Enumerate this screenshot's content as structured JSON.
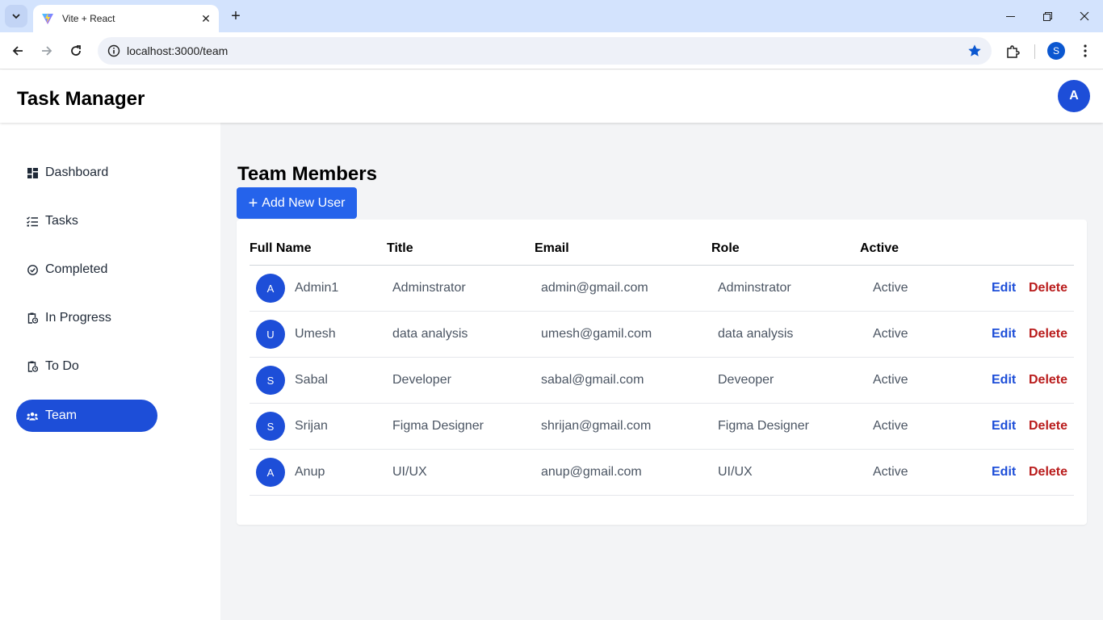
{
  "browser": {
    "tab_title": "Vite + React",
    "url": "localhost:3000/team",
    "profile_initial": "S"
  },
  "app": {
    "title": "Task Manager",
    "user_initial": "A",
    "accent_color": "#1d4ed8"
  },
  "sidebar": {
    "items": [
      {
        "label": "Dashboard",
        "icon": "dashboard-icon"
      },
      {
        "label": "Tasks",
        "icon": "tasks-list-icon"
      },
      {
        "label": "Completed",
        "icon": "check-circle-icon"
      },
      {
        "label": "In Progress",
        "icon": "clipboard-clock-icon"
      },
      {
        "label": "To Do",
        "icon": "clipboard-clock-icon"
      },
      {
        "label": "Team",
        "icon": "users-icon",
        "active": true
      }
    ]
  },
  "main": {
    "title": "Team Members",
    "add_button": "Add New User",
    "columns": [
      "Full Name",
      "Title",
      "Email",
      "Role",
      "Active"
    ],
    "rows": [
      {
        "initial": "A",
        "name": "Admin1",
        "title": "Adminstrator",
        "email": "admin@gmail.com",
        "role": "Adminstrator",
        "status": "Active"
      },
      {
        "initial": "U",
        "name": "Umesh",
        "title": "data analysis",
        "email": "umesh@gamil.com",
        "role": "data analysis",
        "status": "Active"
      },
      {
        "initial": "S",
        "name": "Sabal",
        "title": "Developer",
        "email": "sabal@gmail.com",
        "role": "Deveoper",
        "status": "Active"
      },
      {
        "initial": "S",
        "name": "Srijan",
        "title": "Figma Designer",
        "email": "shrijan@gmail.com",
        "role": "Figma Designer",
        "status": "Active"
      },
      {
        "initial": "A",
        "name": "Anup",
        "title": "UI/UX",
        "email": "anup@gmail.com",
        "role": "UI/UX",
        "status": "Active"
      }
    ],
    "edit_label": "Edit",
    "delete_label": "Delete"
  }
}
